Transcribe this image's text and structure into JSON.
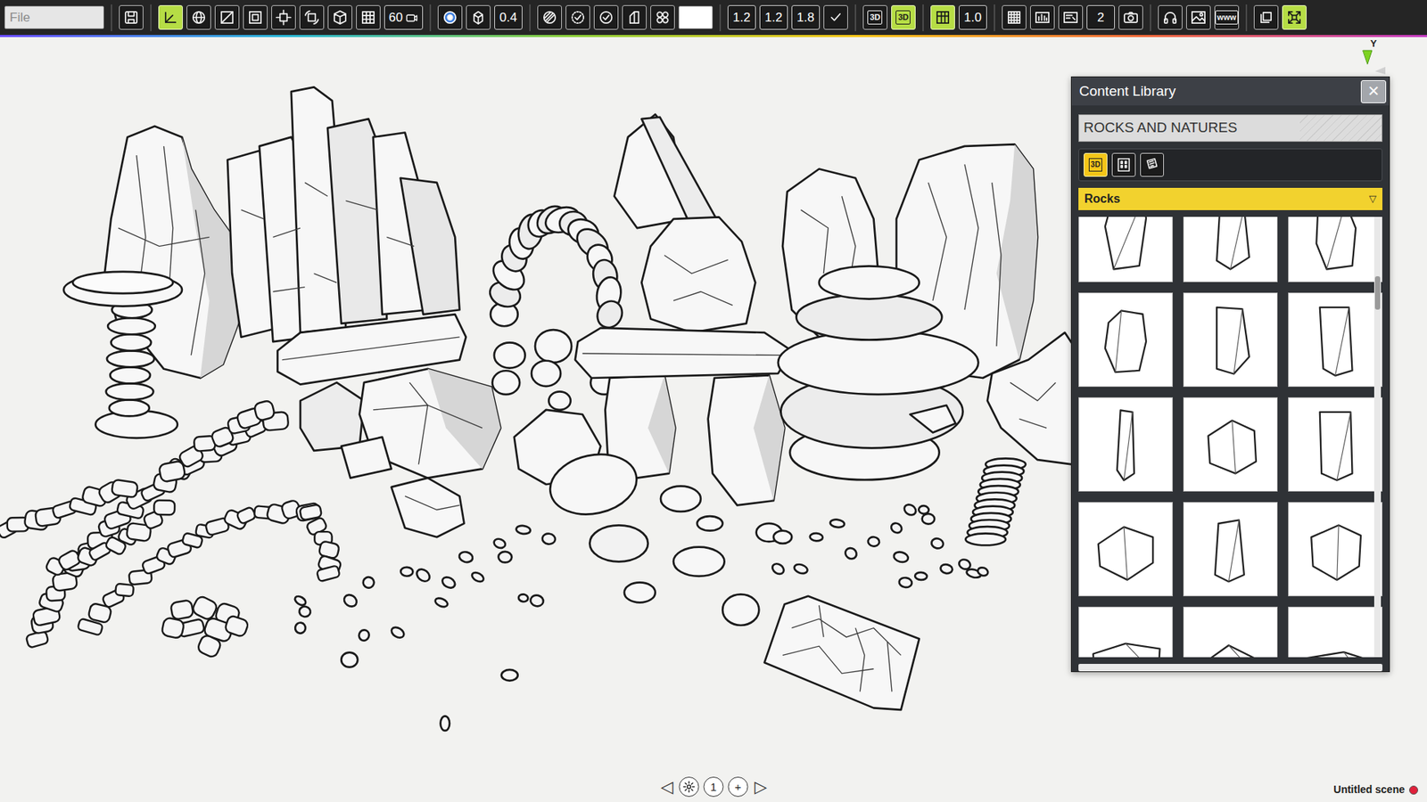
{
  "toolbar": [
    {
      "items": [
        {
          "kind": "field",
          "placeholder": "File"
        }
      ]
    },
    {
      "items": [
        {
          "kind": "button",
          "selected": false
        }
      ]
    },
    {
      "items": [
        {
          "kind": "button",
          "selected": true
        },
        {
          "kind": "button",
          "selected": false
        },
        {
          "kind": "button",
          "selected": false
        },
        {
          "kind": "button",
          "selected": false
        },
        {
          "kind": "button",
          "selected": false
        },
        {
          "kind": "button",
          "selected": false
        },
        {
          "kind": "button",
          "selected": false
        },
        {
          "kind": "button",
          "selected": false
        },
        {
          "kind": "value",
          "text": "60"
        }
      ]
    },
    {
      "items": [
        {
          "kind": "button",
          "selected": false
        },
        {
          "kind": "button",
          "selected": false
        },
        {
          "kind": "value",
          "text": "0.4"
        }
      ]
    },
    {
      "items": [
        {
          "kind": "button",
          "selected": false
        },
        {
          "kind": "button",
          "selected": false
        },
        {
          "kind": "button",
          "selected": false
        },
        {
          "kind": "button",
          "selected": false
        },
        {
          "kind": "button",
          "selected": false
        },
        {
          "kind": "swatch"
        }
      ]
    },
    {
      "items": [
        {
          "kind": "value",
          "text": "1.2"
        },
        {
          "kind": "value",
          "text": "1.2"
        },
        {
          "kind": "value",
          "text": "1.8"
        },
        {
          "kind": "button",
          "selected": false
        }
      ]
    },
    {
      "items": [
        {
          "kind": "button",
          "label": "3D",
          "selected": false
        },
        {
          "kind": "button",
          "label": "3D",
          "selected": true
        }
      ]
    },
    {
      "items": [
        {
          "kind": "button",
          "selected": true
        },
        {
          "kind": "value",
          "text": "1.0"
        }
      ]
    },
    {
      "items": [
        {
          "kind": "button",
          "selected": false
        },
        {
          "kind": "button",
          "selected": false
        },
        {
          "kind": "button",
          "selected": false
        },
        {
          "kind": "value",
          "text": "2"
        },
        {
          "kind": "button",
          "selected": false
        }
      ]
    },
    {
      "items": [
        {
          "kind": "button",
          "selected": false
        },
        {
          "kind": "button",
          "selected": false
        },
        {
          "kind": "button",
          "label": "www",
          "selected": false
        }
      ]
    },
    {
      "items": [
        {
          "kind": "button",
          "selected": false
        },
        {
          "kind": "button",
          "selected": true
        }
      ]
    }
  ],
  "gizmo": {
    "axis_label": "Y"
  },
  "library": {
    "title": "Content Library",
    "close": "×",
    "search": "ROCKS AND NATURES",
    "tabs": [
      {
        "label": "3D",
        "selected": true
      },
      {
        "selected": false
      },
      {
        "selected": false
      }
    ],
    "category": {
      "label": "Rocks",
      "arrow": "▽"
    }
  },
  "pager": {
    "prev": "◁",
    "page": "1",
    "add": "+",
    "next": "▷"
  },
  "status_bar": {
    "scene": "Untitled scene",
    "modified": true
  }
}
